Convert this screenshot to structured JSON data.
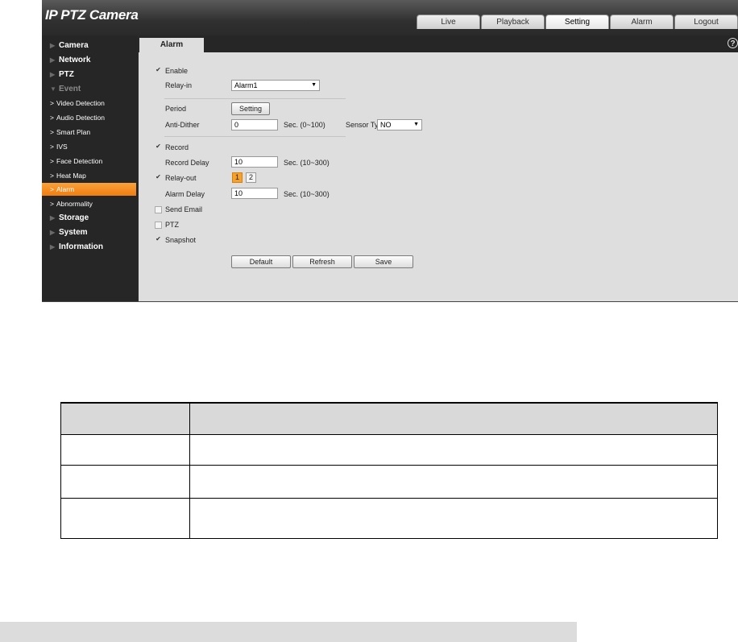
{
  "app": {
    "title": "IP PTZ Camera",
    "title_part1": "IP ",
    "title_part2": "PTZ Camera"
  },
  "tabs": [
    {
      "label": "Live",
      "active": false
    },
    {
      "label": "Playback",
      "active": false
    },
    {
      "label": "Setting",
      "active": true
    },
    {
      "label": "Alarm",
      "active": false
    },
    {
      "label": "Logout",
      "active": false
    }
  ],
  "sidebar": {
    "items": [
      {
        "label": "Camera"
      },
      {
        "label": "Network"
      },
      {
        "label": "PTZ"
      },
      {
        "label": "Event"
      },
      {
        "label": "Video Detection"
      },
      {
        "label": "Audio Detection"
      },
      {
        "label": "Smart Plan"
      },
      {
        "label": "IVS"
      },
      {
        "label": "Face Detection"
      },
      {
        "label": "Heat Map"
      },
      {
        "label": "Alarm"
      },
      {
        "label": "Abnormality"
      },
      {
        "label": "Storage"
      },
      {
        "label": "System"
      },
      {
        "label": "Information"
      }
    ],
    "active_item": "Alarm"
  },
  "page": {
    "tab_label": "Alarm",
    "help_icon": "?"
  },
  "form": {
    "enable": {
      "label": "Enable",
      "checked": true
    },
    "relay_in": {
      "label": "Relay-in",
      "value": "Alarm1"
    },
    "period": {
      "label": "Period",
      "button": "Setting"
    },
    "anti_dither": {
      "label": "Anti-Dither",
      "value": "0",
      "unit": "Sec. (0~100)"
    },
    "sensor_type": {
      "label": "Sensor Type",
      "value": "NO"
    },
    "record": {
      "label": "Record",
      "checked": true
    },
    "record_delay": {
      "label": "Record Delay",
      "value": "10",
      "unit": "Sec. (10~300)"
    },
    "relay_out": {
      "label": "Relay-out",
      "checked": true,
      "channels": [
        "1",
        "2"
      ],
      "selected": "1"
    },
    "alarm_delay": {
      "label": "Alarm Delay",
      "value": "10",
      "unit": "Sec. (10~300)"
    },
    "send_email": {
      "label": "Send Email",
      "checked": false
    },
    "ptz": {
      "label": "PTZ",
      "checked": false
    },
    "snapshot": {
      "label": "Snapshot",
      "checked": true
    }
  },
  "buttons": {
    "default": "Default",
    "refresh": "Refresh",
    "save": "Save"
  },
  "colors": {
    "accent": "#f5a12c",
    "sidebar_bg": "#262626",
    "content_bg": "#dedede"
  }
}
